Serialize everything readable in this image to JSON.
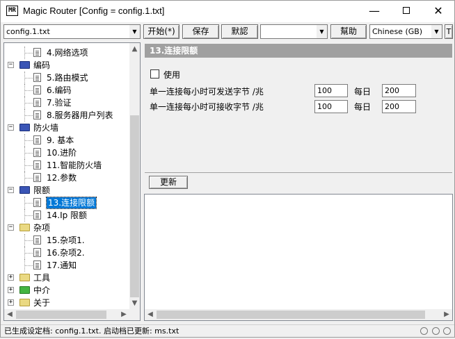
{
  "window": {
    "app_icon_text": "MR",
    "title": "Magic Router [Config = config.1.txt]",
    "minimize": "—",
    "close": "✕"
  },
  "toolbar": {
    "config_combo": "config.1.txt",
    "start_button": "开始(*)",
    "save_button": "保存",
    "default_button": "默認",
    "empty_combo": "",
    "help_button": "幫助",
    "language_combo": "Chinese (GB)",
    "extra_button": "T"
  },
  "tree": {
    "items": [
      {
        "label": "4.网络选项",
        "type": "leaf"
      },
      {
        "label": "编码",
        "type": "folder-open",
        "expander": "−"
      },
      {
        "label": "5.路由模式",
        "type": "leaf"
      },
      {
        "label": "6.编码",
        "type": "leaf"
      },
      {
        "label": "7.验证",
        "type": "leaf"
      },
      {
        "label": "8.服务器用户列表",
        "type": "leaf"
      },
      {
        "label": "防火墙",
        "type": "folder-open",
        "expander": "−"
      },
      {
        "label": "9. 基本",
        "type": "leaf"
      },
      {
        "label": "10.进阶",
        "type": "leaf"
      },
      {
        "label": "11.智能防火墙",
        "type": "leaf"
      },
      {
        "label": "12.参数",
        "type": "leaf"
      },
      {
        "label": "限额",
        "type": "folder-open",
        "expander": "−"
      },
      {
        "label": "13.连接限额",
        "type": "leaf",
        "selected": true
      },
      {
        "label": "14.Ip 限额",
        "type": "leaf"
      },
      {
        "label": "杂项",
        "type": "folder-closed",
        "expander": "−"
      },
      {
        "label": "15.杂项1.",
        "type": "leaf"
      },
      {
        "label": "16.杂项2.",
        "type": "leaf"
      },
      {
        "label": "17.通知",
        "type": "leaf"
      },
      {
        "label": "工具",
        "type": "folder-closed",
        "expander": "+"
      },
      {
        "label": "中介",
        "type": "folder-green",
        "expander": "+"
      },
      {
        "label": "关于",
        "type": "folder-closed",
        "expander": "+"
      }
    ]
  },
  "panel": {
    "header": "13.连接限额",
    "use_checkbox_label": "使用",
    "rows": [
      {
        "label": "单一连接每小时可发送字节 /兆",
        "hourly": "100",
        "daily_label": "每日",
        "daily": "200"
      },
      {
        "label": "单一连接每小时可接收字节 /兆",
        "hourly": "100",
        "daily_label": "每日",
        "daily": "200"
      }
    ],
    "update_button": "更新"
  },
  "status": {
    "text": "已生成设定档: config.1.txt. 启动档已更新: ms.txt"
  },
  "colors": {
    "selection": "#0078d7",
    "header_bg": "#a0a0a0"
  }
}
